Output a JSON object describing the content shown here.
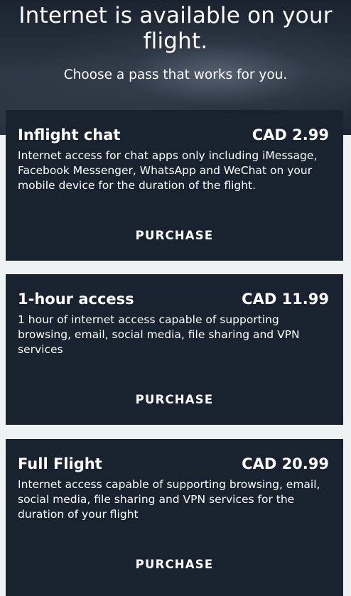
{
  "header": {
    "title": "Internet is available on your flight.",
    "subtitle": "Choose a pass that works for you."
  },
  "passes": [
    {
      "name": "Inflight chat",
      "price": "CAD 2.99",
      "description": "Internet access for chat apps only including iMes­sage, Facebook Messenger, WhatsApp and WeChat on your mobile device for the duration of the flight.",
      "action_label": "PURCHASE"
    },
    {
      "name": "1-hour access",
      "price": "CAD 11.99",
      "description": "1 hour of internet access capable of supporting browsing, email, social media, file shar­ing and VPN services",
      "action_label": "PURCHASE"
    },
    {
      "name": "Full Flight",
      "price": "CAD 20.99",
      "description": "Internet access capable of supporting browsing, email, social media, file sharing and VPN services for the duration of your flight",
      "action_label": "PURCHASE"
    }
  ]
}
